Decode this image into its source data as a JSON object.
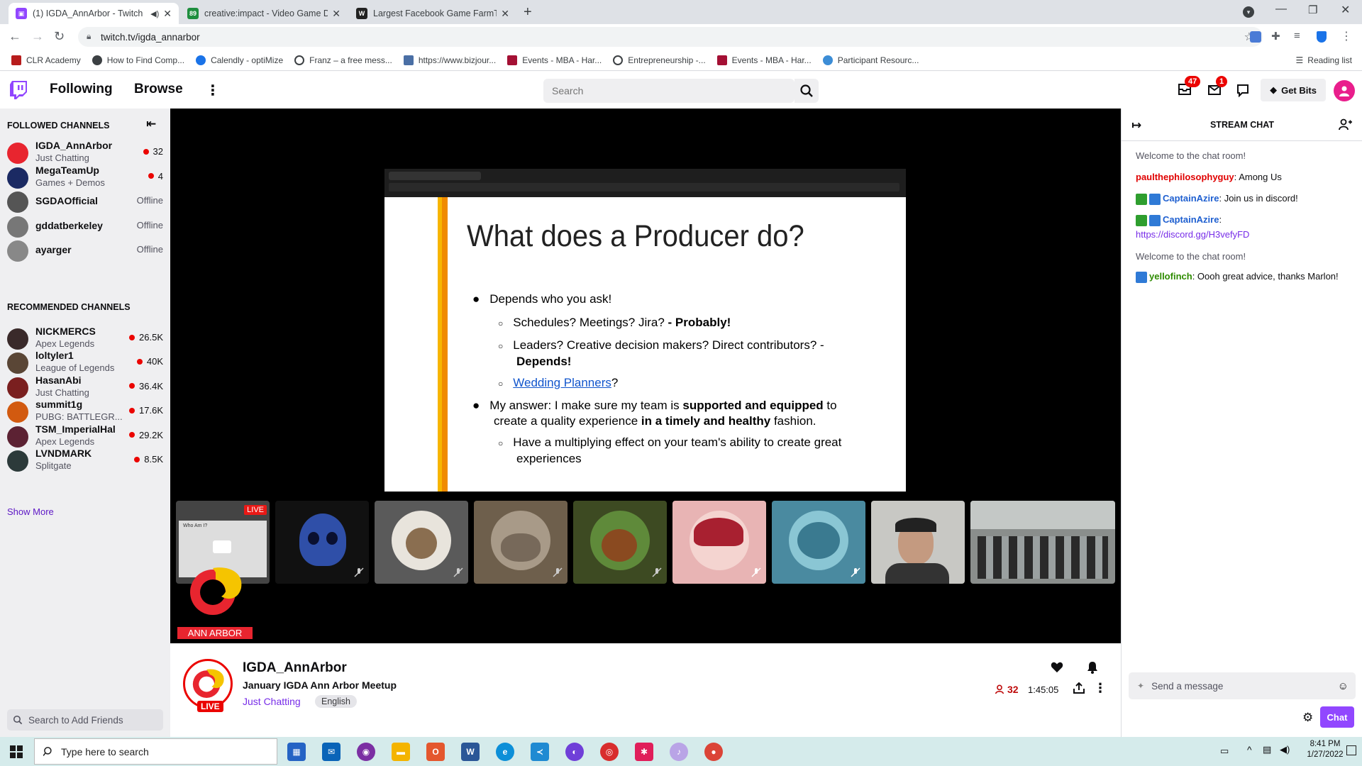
{
  "browser": {
    "tabs": [
      {
        "title": "(1) IGDA_AnnArbor - Twitch",
        "active": true
      },
      {
        "title": "creative:impact - Video Game De",
        "active": false
      },
      {
        "title": "Largest Facebook Game FarmTow",
        "active": false
      }
    ],
    "url": "twitch.tv/igda_annarbor",
    "bookmarks": [
      "CLR Academy",
      "How to Find Comp...",
      "Calendly - optiMize",
      "Franz – a free mess...",
      "https://www.bizjour...",
      "Events - MBA - Har...",
      "Entrepreneurship -...",
      "Events - MBA - Har...",
      "Participant Resourc..."
    ],
    "reading_list": "Reading list"
  },
  "nav": {
    "following": "Following",
    "browse": "Browse",
    "search_placeholder": "Search",
    "inbox_badge": "47",
    "whispers_badge": "1",
    "get_bits": "Get Bits"
  },
  "sidebar": {
    "followed_title": "FOLLOWED CHANNELS",
    "followed": [
      {
        "name": "IGDA_AnnArbor",
        "game": "Just Chatting",
        "viewers": "32",
        "live": true,
        "color": "#e8252f"
      },
      {
        "name": "MegaTeamUp",
        "game": "Games + Demos",
        "viewers": "4",
        "live": true,
        "color": "#1b2a63"
      },
      {
        "name": "SGDAOfficial",
        "game": "",
        "viewers": "Offline",
        "live": false,
        "color": "#555"
      },
      {
        "name": "gddatberkeley",
        "game": "",
        "viewers": "Offline",
        "live": false,
        "color": "#777"
      },
      {
        "name": "ayarger",
        "game": "",
        "viewers": "Offline",
        "live": false,
        "color": "#888"
      }
    ],
    "recommended_title": "RECOMMENDED CHANNELS",
    "recommended": [
      {
        "name": "NICKMERCS",
        "game": "Apex Legends",
        "viewers": "26.5K",
        "color": "#3a2a2a"
      },
      {
        "name": "loltyler1",
        "game": "League of Legends",
        "viewers": "40K",
        "color": "#5a4636"
      },
      {
        "name": "HasanAbi",
        "game": "Just Chatting",
        "viewers": "36.4K",
        "color": "#7a1f1f"
      },
      {
        "name": "summit1g",
        "game": "PUBG: BATTLEGR...",
        "viewers": "17.6K",
        "color": "#d25a10"
      },
      {
        "name": "TSM_ImperialHal",
        "game": "Apex Legends",
        "viewers": "29.2K",
        "color": "#5c2233"
      },
      {
        "name": "LVNDMARK",
        "game": "Splitgate",
        "viewers": "8.5K",
        "color": "#2c3a3a"
      }
    ],
    "show_more": "Show More",
    "friend_search_placeholder": "Search to Add Friends"
  },
  "player": {
    "slide": {
      "title": "What does a Producer do?",
      "b1": "Depends who you ask!",
      "b1a_plain": "Schedules? Meetings? Jira? ",
      "b1a_bold": "- Probably!",
      "b1b_plain": "Leaders? Creative decision makers? Direct contributors? - ",
      "b1b_bold": "Depends!",
      "b1c_link": "Wedding Planners",
      "b1c_after": "?",
      "b2_p1": "My answer: I make sure my team is ",
      "b2_b1": "supported and equipped",
      "b2_p2": " to create a quality experience ",
      "b2_b2": "in a timely and healthy",
      "b2_p3": " fashion.",
      "b2a": "Have a multiplying effect on your team's ability to create great experiences"
    },
    "live_tag": "LIVE",
    "slide_thumb_title": "Who Am I?",
    "banner": "ANN ARBOR"
  },
  "stream": {
    "channel": "IGDA_AnnArbor",
    "title": "January IGDA Ann Arbor Meetup",
    "category": "Just Chatting",
    "tag": "English",
    "live": "LIVE",
    "viewers": "32",
    "uptime": "1:45:05"
  },
  "chat": {
    "header": "STREAM CHAT",
    "messages": [
      {
        "type": "system",
        "text": "Welcome to the chat room!"
      },
      {
        "type": "user",
        "user": "paulthephilosophyguy",
        "color": "#e00000",
        "text": "Among Us"
      },
      {
        "type": "user",
        "user": "CaptainAzire",
        "color": "#1e5fd0",
        "text": "Join us in discord!"
      },
      {
        "type": "user",
        "user": "CaptainAzire",
        "color": "#1e5fd0",
        "text": "https://discord.gg/H3vefyFD"
      },
      {
        "type": "system",
        "text": "Welcome to the chat room!"
      },
      {
        "type": "user",
        "user": "yellofinch",
        "color": "#2e8b00",
        "text": "Oooh great advice, thanks Marlon!"
      }
    ],
    "input_placeholder": "Send a message",
    "chat_button": "Chat"
  },
  "taskbar": {
    "search_placeholder": "Type here to search",
    "time": "8:41 PM",
    "date": "1/27/2022"
  }
}
